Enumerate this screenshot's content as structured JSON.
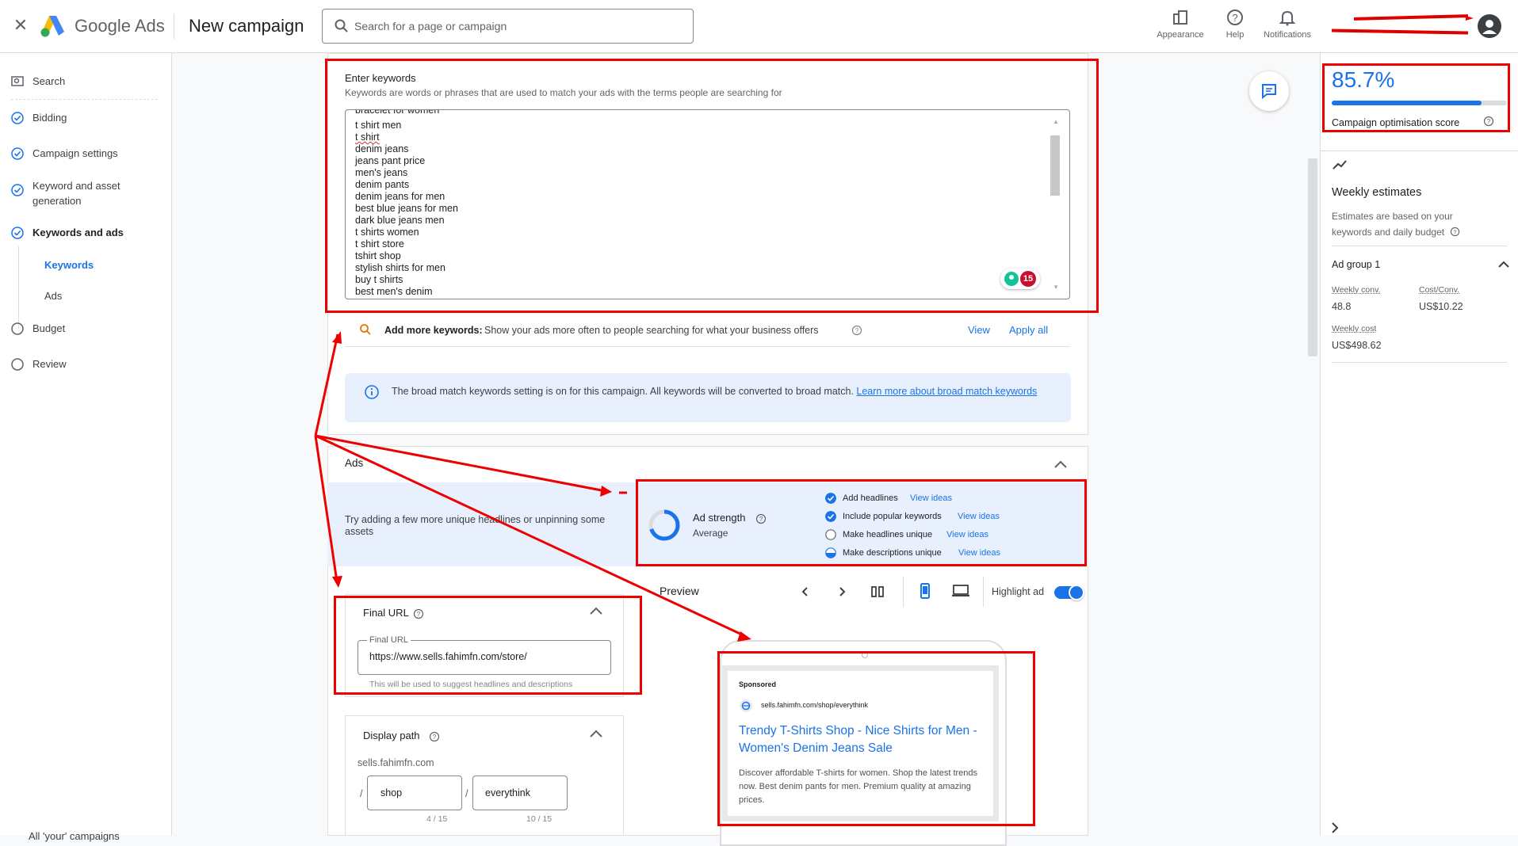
{
  "header": {
    "brand": "Google Ads",
    "page_title": "New campaign",
    "search_placeholder": "Search for a page or campaign",
    "actions": [
      {
        "label": "Appearance",
        "icon": "appearance-icon"
      },
      {
        "label": "Help",
        "icon": "help-icon"
      },
      {
        "label": "Notifications",
        "icon": "bell-icon"
      }
    ]
  },
  "sidebar": {
    "items": [
      {
        "label": "Search",
        "icon": "search-campaign-icon"
      },
      {
        "label": "Bidding",
        "icon": "check-circle-icon"
      },
      {
        "label": "Campaign settings",
        "icon": "check-circle-icon"
      },
      {
        "label": "Keyword and asset generation",
        "icon": "check-circle-icon"
      },
      {
        "label": "Keywords and ads",
        "icon": "check-circle-icon"
      },
      {
        "label": "Budget",
        "icon": "empty-circle-icon"
      },
      {
        "label": "Review",
        "icon": "empty-circle-icon"
      }
    ],
    "subitems": [
      {
        "label": "Keywords"
      },
      {
        "label": "Ads"
      }
    ],
    "bottom_partial": "All 'your' campaigns"
  },
  "keywords": {
    "title": "Enter keywords",
    "subtitle": "Keywords are words or phrases that are used to match your ads with the terms people are searching for",
    "lines": [
      "bracelet for women",
      "t shirt men",
      "t shirt",
      "denim jeans",
      "jeans pant price",
      "men's jeans",
      "denim pants",
      "denim jeans for men",
      "best blue jeans for men",
      "dark blue jeans men",
      "t shirts women",
      "t shirt store",
      "tshirt shop",
      "stylish shirts for men",
      "buy t shirts",
      "best men's denim"
    ],
    "grammar_count": "15",
    "add_more_bold": "Add more keywords:",
    "add_more_text": "Show your ads more often to people searching for what your business offers",
    "view": "View",
    "apply_all": "Apply all",
    "info_text": "The broad match keywords setting is on for this campaign. All keywords will be converted to broad match.",
    "info_link": "Learn more about broad match keywords"
  },
  "ads": {
    "title": "Ads",
    "tip": "Try adding a few more unique headlines or unpinning some assets",
    "strength_label": "Ad strength",
    "strength_value": "Average",
    "checklist": [
      {
        "text": "Add headlines",
        "link": "View ideas",
        "state": "done"
      },
      {
        "text": "Include popular keywords",
        "link": "View ideas",
        "state": "done"
      },
      {
        "text": "Make headlines unique",
        "link": "View ideas",
        "state": "empty"
      },
      {
        "text": "Make descriptions unique",
        "link": "View ideas",
        "state": "half"
      }
    ],
    "final_url": {
      "title": "Final URL",
      "field_label": "Final URL",
      "value": "https://www.sells.fahimfn.com/store/",
      "helper": "This will be used to suggest headlines and descriptions"
    },
    "display_path": {
      "title": "Display path",
      "domain": "sells.fahimfn.com",
      "sep": "/",
      "path1": "shop",
      "path2": "everythink",
      "count1": "4 / 15",
      "count2": "10 / 15"
    },
    "preview": {
      "label": "Preview",
      "highlight": "Highlight ad",
      "sponsored": "Sponsored",
      "url": "sells.fahimfn.com/shop/everythink",
      "headline": "Trendy T-Shirts Shop - Nice Shirts for Men - Women's Denim Jeans Sale",
      "description": "Discover affordable T-shirts for women. Shop the latest trends now. Best denim pants for men. Premium quality at amazing prices."
    }
  },
  "right_panel": {
    "score": "85.7%",
    "score_fraction": 0.857,
    "score_label": "Campaign optimisation score",
    "weekly_title": "Weekly estimates",
    "weekly_desc": "Estimates are based on your keywords and daily budget",
    "ad_group": "Ad group 1",
    "conv_label": "Weekly conv.",
    "conv_value": "48.8",
    "cost_conv_label": "Cost/Conv.",
    "cost_conv_value": "US$10.22",
    "weekly_cost_label": "Weekly cost",
    "weekly_cost_value": "US$498.62"
  },
  "colors": {
    "accent": "#1a73e8",
    "annotation_red": "#e00000",
    "info_bg": "#e8f0fe"
  }
}
